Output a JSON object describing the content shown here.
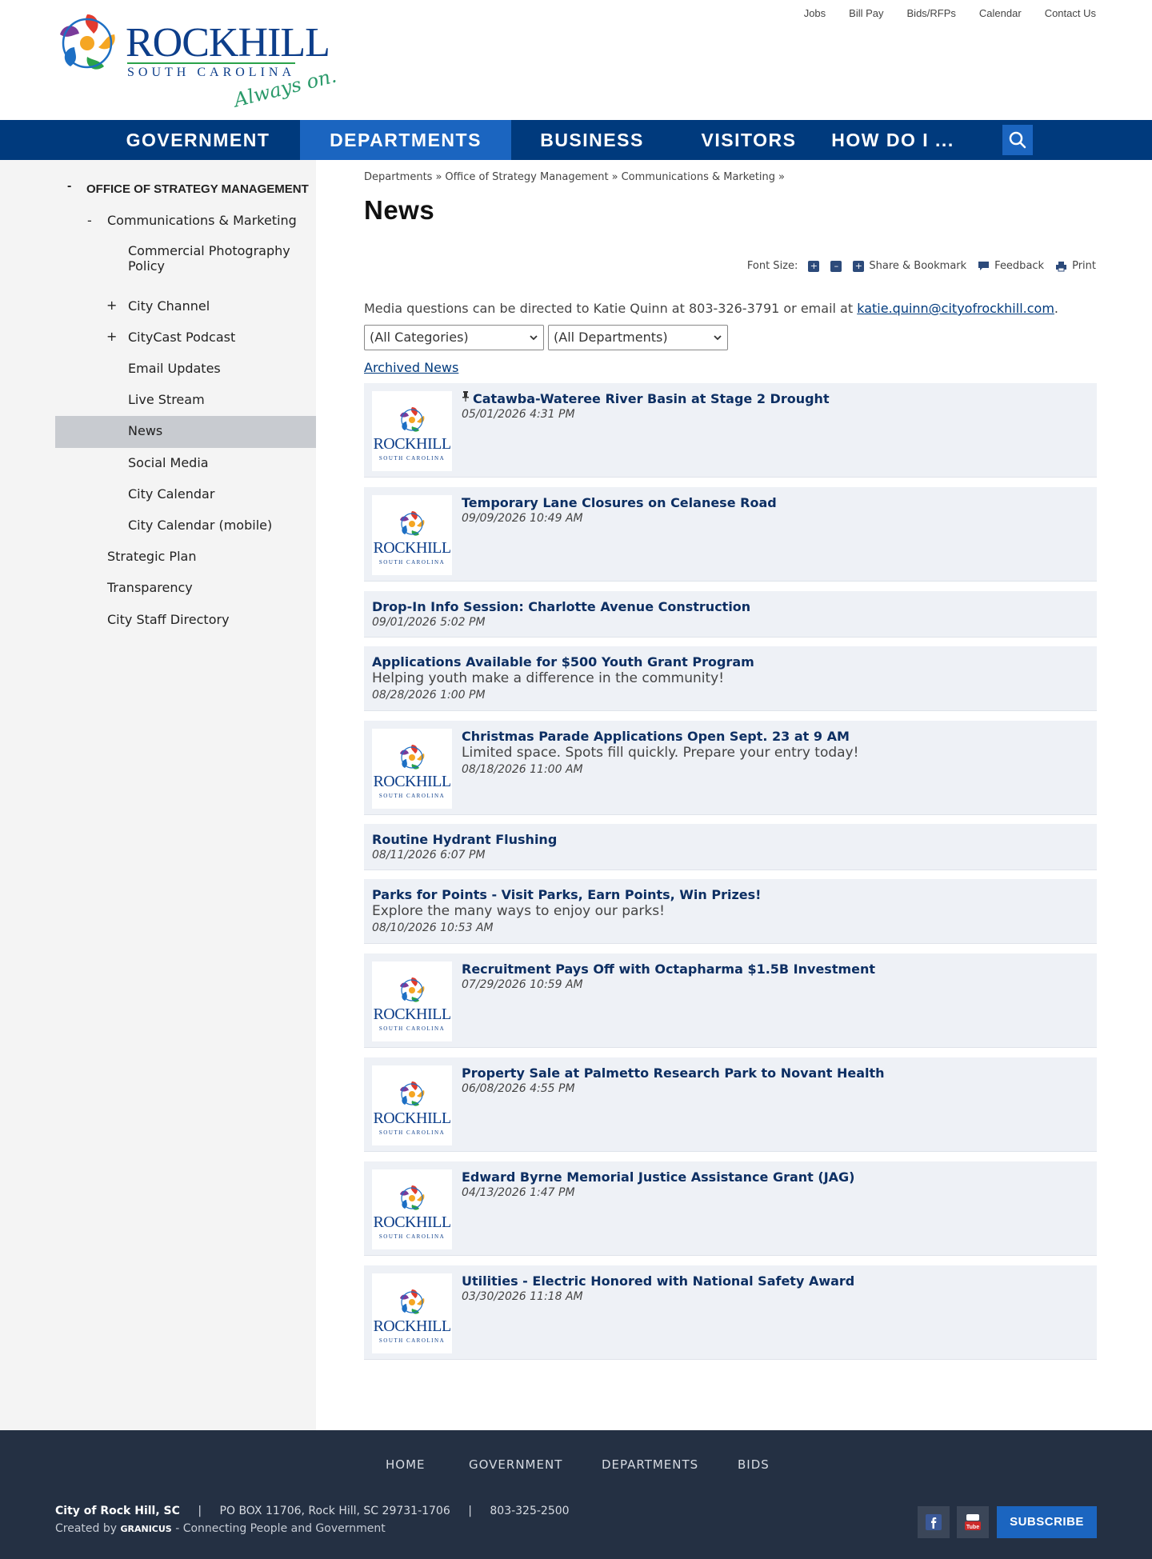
{
  "brand": {
    "name_line1": "ROCKHILL",
    "name_line2": "SOUTH CAROLINA",
    "tagline": "Always on."
  },
  "utility_nav": [
    "Jobs",
    "Bill Pay",
    "Bids/RFPs",
    "Calendar",
    "Contact Us"
  ],
  "main_nav": [
    "GOVERNMENT",
    "DEPARTMENTS",
    "BUSINESS",
    "VISITORS",
    "HOW DO I ..."
  ],
  "sidebar": {
    "top_toggle": "-",
    "top_label": "OFFICE OF STRATEGY MANAGEMENT",
    "sub_toggle": "-",
    "sub_label": "Communications & Marketing",
    "items": [
      {
        "toggle": "",
        "label": "Commercial Photography Policy"
      },
      {
        "toggle": "+",
        "label": "City Channel"
      },
      {
        "toggle": "+",
        "label": "CityCast Podcast"
      },
      {
        "toggle": "",
        "label": "Email Updates"
      },
      {
        "toggle": "",
        "label": "Live Stream"
      },
      {
        "toggle": "",
        "label": "News"
      },
      {
        "toggle": "",
        "label": "Social Media"
      },
      {
        "toggle": "",
        "label": "City Calendar"
      },
      {
        "toggle": "",
        "label": "City Calendar (mobile)"
      }
    ],
    "siblings": [
      "Strategic Plan",
      "Transparency",
      "City Staff Directory"
    ]
  },
  "breadcrumb": [
    "Departments",
    "Office of Strategy Management",
    "Communications & Marketing"
  ],
  "breadcrumb_sep": "»",
  "page_title": "News",
  "tools": {
    "font_size_label": "Font Size:",
    "plus": "+",
    "minus": "–",
    "share_label": "Share & Bookmark",
    "feedback_label": "Feedback",
    "print_label": "Print"
  },
  "intro": {
    "text": "Media questions can be directed to Katie Quinn at 803-326-3791 or email at",
    "email": "katie.quinn@cityofrockhill.com",
    "end": "."
  },
  "filters": {
    "categories": "(All Categories)",
    "departments": "(All Departments)"
  },
  "archived_label": "Archived News",
  "thumb_text": {
    "line1": "ROCKHILL",
    "line2": "SOUTH CAROLINA"
  },
  "news": [
    {
      "title": "Catawba-Wateree River Basin at Stage 2 Drought",
      "desc": "",
      "date": "05/01/2026 4:31 PM"
    },
    {
      "title": "Temporary Lane Closures on Celanese Road",
      "desc": "",
      "date": "09/09/2026 10:49 AM"
    },
    {
      "title": "Drop-In Info Session: Charlotte Avenue Construction",
      "desc": "",
      "date": "09/01/2026 5:02 PM"
    },
    {
      "title": "Applications Available for $500 Youth Grant Program",
      "desc": "Helping youth make a difference in the community!",
      "date": "08/28/2026 1:00 PM"
    },
    {
      "title": "Christmas Parade Applications Open Sept. 23 at 9 AM",
      "desc": "Limited space. Spots fill quickly. Prepare your entry today!",
      "date": "08/18/2026 11:00 AM"
    },
    {
      "title": "Routine Hydrant Flushing",
      "desc": "",
      "date": "08/11/2026 6:07 PM"
    },
    {
      "title": "Parks for Points - Visit Parks, Earn Points, Win Prizes!",
      "desc": "Explore the many ways to enjoy our parks!",
      "date": "08/10/2026 10:53 AM"
    },
    {
      "title": "Recruitment Pays Off with Octapharma $1.5B Investment",
      "desc": "",
      "date": "07/29/2026 10:59 AM"
    },
    {
      "title": "Property Sale at Palmetto Research Park to Novant Health",
      "desc": "",
      "date": "06/08/2026 4:55 PM"
    },
    {
      "title": "Edward Byrne Memorial Justice Assistance Grant (JAG)",
      "desc": "",
      "date": "04/13/2026 1:47 PM"
    },
    {
      "title": "Utilities - Electric Honored with National Safety Award",
      "desc": "",
      "date": "03/30/2026 11:18 AM"
    }
  ],
  "footer": {
    "links": [
      "HOME",
      "GOVERNMENT",
      "DEPARTMENTS",
      "BIDS"
    ],
    "org": "City of Rock Hill, SC",
    "sep": "|",
    "address": "PO BOX 11706, Rock Hill, SC 29731-1706",
    "phone": "803-325-2500",
    "credit_prefix": "Created by",
    "credit_brand": "GRANICUS",
    "credit_suffix": "- Connecting People and Government",
    "subscribe": "SUBSCRIBE"
  },
  "colors": {
    "nav": "#003a7d",
    "nav_active": "#1b65c0",
    "footer": "#243043",
    "news_bg": "#eef1f6",
    "link": "#0d2f63"
  }
}
